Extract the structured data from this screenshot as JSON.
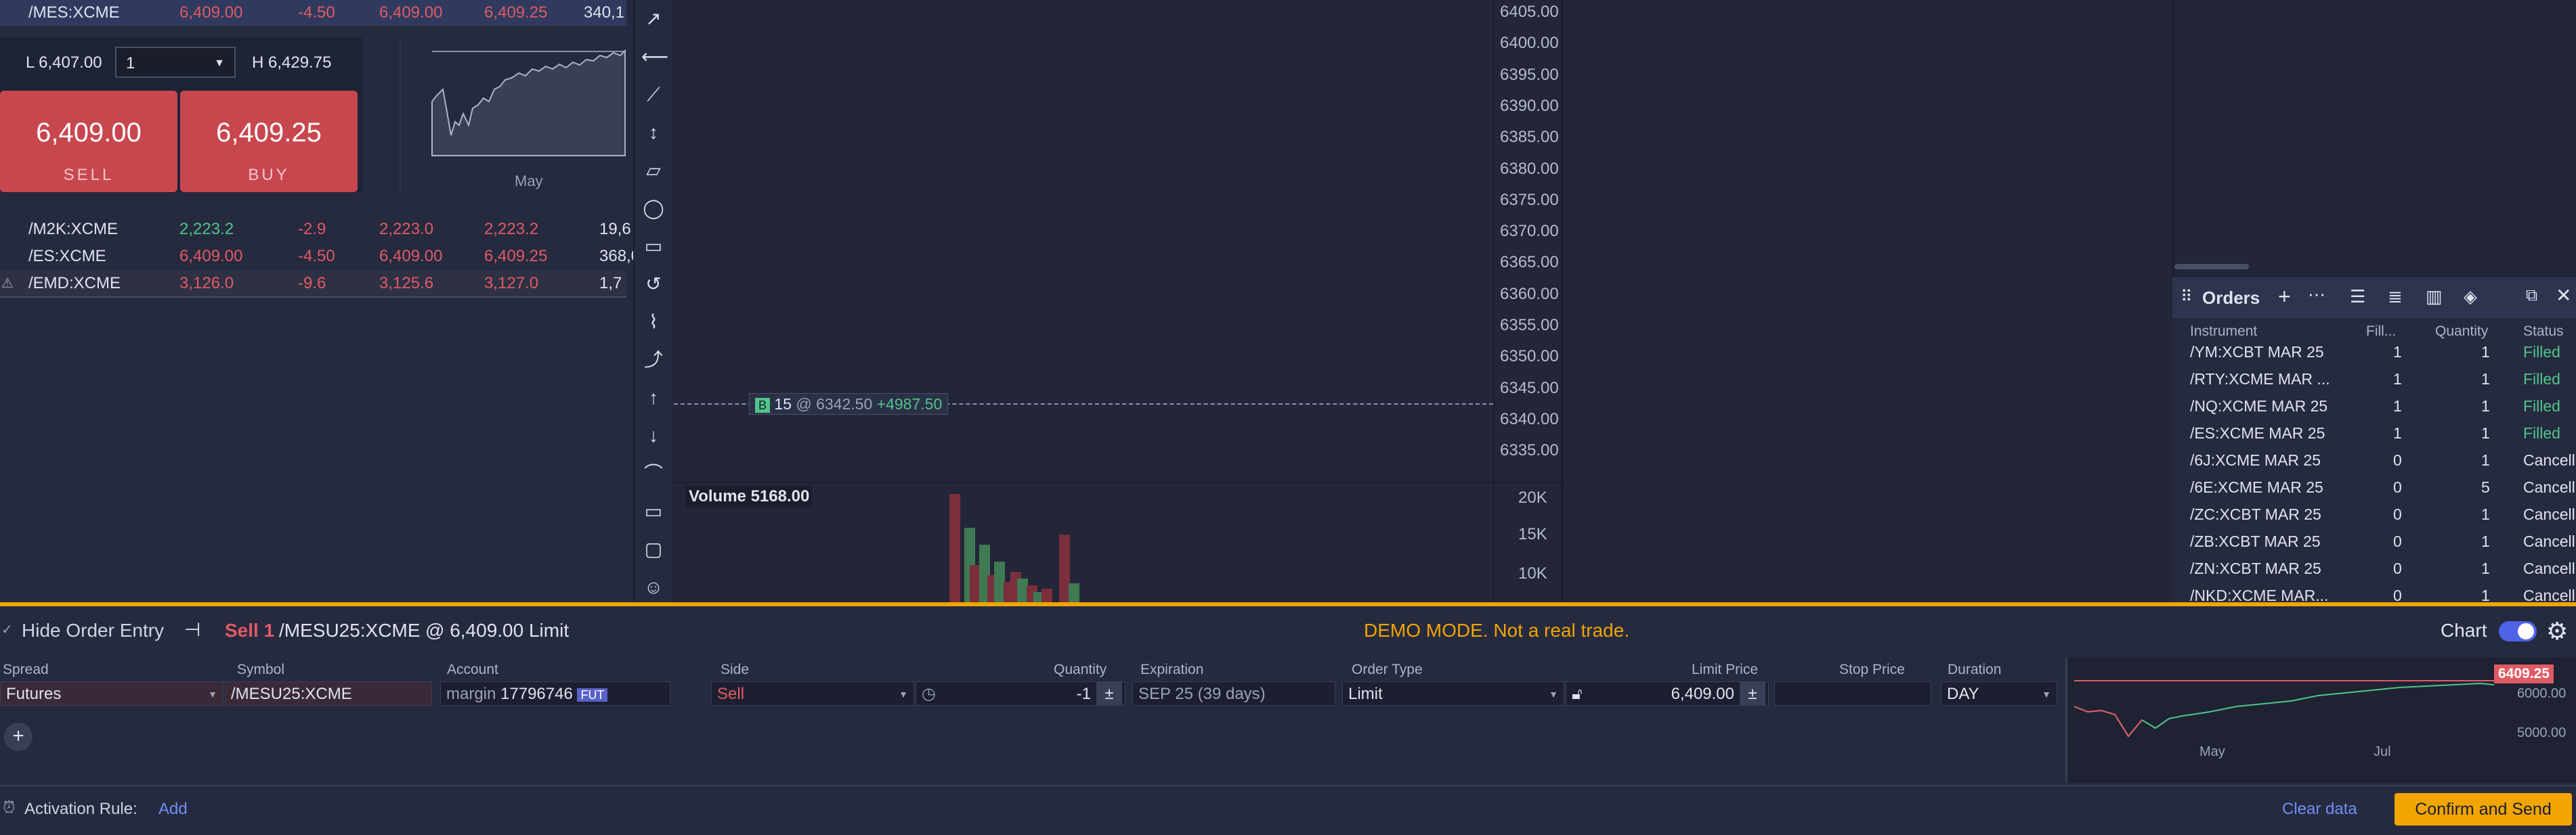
{
  "watchlist": {
    "top_row": {
      "symbol": "/MES:XCME",
      "last": "6,409.00",
      "change": "-4.50",
      "bid": "6,409.00",
      "ask": "6,409.25",
      "volume": "340,1"
    },
    "rows": [
      {
        "symbol": "/M2K:XCME",
        "last": "2,223.2",
        "change": "-2.9",
        "bid": "2,223.0",
        "ask": "2,223.2",
        "volume": "19,6",
        "last_color": "#4fc58a"
      },
      {
        "symbol": "/ES:XCME",
        "last": "6,409.00",
        "change": "-4.50",
        "bid": "6,409.00",
        "ask": "6,409.25",
        "volume": "368,0",
        "last_color": "#e05a64"
      },
      {
        "symbol": "/EMD:XCME",
        "last": "3,126.0",
        "change": "-9.6",
        "bid": "3,125.6",
        "ask": "3,127.0",
        "volume": "1,7",
        "last_color": "#e05a64"
      }
    ]
  },
  "trade_panel": {
    "low": "L 6,407.00",
    "high": "H 6,429.75",
    "qty": "1",
    "sell_price": "6,409.00",
    "sell_label": "SELL",
    "buy_price": "6,409.25",
    "buy_label": "BUY",
    "spark_label": "May"
  },
  "chart": {
    "y_ticks": [
      "6405.00",
      "6400.00",
      "6395.00",
      "6390.00",
      "6385.00",
      "6380.00",
      "6375.00",
      "6370.00",
      "6365.00",
      "6360.00",
      "6355.00",
      "6350.00",
      "6345.00",
      "6340.00",
      "6335.00"
    ],
    "position_badge": "B",
    "position_qty": "15",
    "position_at": "@ 6342.50",
    "position_pl": "+4987.50",
    "volume_label": "Volume 5168.00",
    "volume_ticks": [
      "20K",
      "15K",
      "10K"
    ],
    "volume_bars": [
      {
        "color": "#7a2f3b",
        "h": 160
      },
      {
        "color": "#3f7a52",
        "h": 110
      },
      {
        "color": "#7a2f3b",
        "h": 55
      },
      {
        "color": "#3f7a52",
        "h": 85
      },
      {
        "color": "#7a2f3b",
        "h": 40
      },
      {
        "color": "#3f7a52",
        "h": 60
      },
      {
        "color": "#7a2f3b",
        "h": 30
      },
      {
        "color": "#7a2f3b",
        "h": 45
      },
      {
        "color": "#3f7a52",
        "h": 35
      },
      {
        "color": "#7a2f3b",
        "h": 25
      },
      {
        "color": "#3f7a52",
        "h": 15
      },
      {
        "color": "#7a2f3b",
        "h": 20
      },
      {
        "color": "#7a2f3b",
        "h": 100
      },
      {
        "color": "#3f7a52",
        "h": 28
      }
    ]
  },
  "orders": {
    "title": "Orders",
    "columns": [
      "Instrument",
      "Fill...",
      "Quantity",
      "Status"
    ],
    "rows": [
      {
        "instrument": "/YM:XCBT  MAR 25",
        "fill": "1",
        "qty": "1",
        "status": "Filled",
        "status_color": "#4fc58a"
      },
      {
        "instrument": "/RTY:XCME  MAR ...",
        "fill": "1",
        "qty": "1",
        "status": "Filled",
        "status_color": "#4fc58a"
      },
      {
        "instrument": "/NQ:XCME  MAR 25",
        "fill": "1",
        "qty": "1",
        "status": "Filled",
        "status_color": "#4fc58a"
      },
      {
        "instrument": "/ES:XCME  MAR 25",
        "fill": "1",
        "qty": "1",
        "status": "Filled",
        "status_color": "#4fc58a"
      },
      {
        "instrument": "/6J:XCME  MAR 25",
        "fill": "0",
        "qty": "1",
        "status": "Cancell",
        "status_color": "#dfe3ee"
      },
      {
        "instrument": "/6E:XCME  MAR 25",
        "fill": "0",
        "qty": "5",
        "status": "Cancell",
        "status_color": "#dfe3ee"
      },
      {
        "instrument": "/ZC:XCBT  MAR 25",
        "fill": "0",
        "qty": "1",
        "status": "Cancell",
        "status_color": "#dfe3ee"
      },
      {
        "instrument": "/ZB:XCBT  MAR 25",
        "fill": "0",
        "qty": "1",
        "status": "Cancell",
        "status_color": "#dfe3ee"
      },
      {
        "instrument": "/ZN:XCBT  MAR 25",
        "fill": "0",
        "qty": "1",
        "status": "Cancell",
        "status_color": "#dfe3ee"
      },
      {
        "instrument": "/NKD:XCME  MAR...",
        "fill": "0",
        "qty": "1",
        "status": "Cancell",
        "status_color": "#dfe3ee"
      }
    ]
  },
  "order_entry": {
    "hide_label": "Hide Order Entry",
    "sell_text": "Sell 1",
    "symbol_text": "/MESU25:XCME",
    "price_text": "@ 6,409.00 Limit",
    "demo_text": "DEMO MODE. Not a real trade.",
    "chart_toggle_label": "Chart",
    "headers": {
      "spread": "Spread",
      "symbol": "Symbol",
      "account": "Account",
      "side": "Side",
      "quantity": "Quantity",
      "expiration": "Expiration",
      "order_type": "Order Type",
      "limit_price": "Limit Price",
      "stop_price": "Stop Price",
      "duration": "Duration"
    },
    "values": {
      "spread": "Futures",
      "symbol": "/MESU25:XCME",
      "account_prefix": "margin",
      "account_number": "17796746",
      "account_badge": "FUT",
      "side": "Sell",
      "quantity": "-1",
      "expiration": "SEP 25 (39 days)",
      "order_type": "Limit",
      "limit_price": "6,409.00",
      "stop_price": "",
      "duration": "DAY"
    },
    "mini_chart": {
      "price_tag": "6409.25",
      "y_ticks": [
        "6000.00",
        "5000.00"
      ],
      "x_ticks": [
        "May",
        "Jul"
      ]
    }
  },
  "footer": {
    "activation_label": "Activation Rule:",
    "add_link": "Add",
    "clear_label": "Clear data",
    "confirm_label": "Confirm and Send"
  }
}
